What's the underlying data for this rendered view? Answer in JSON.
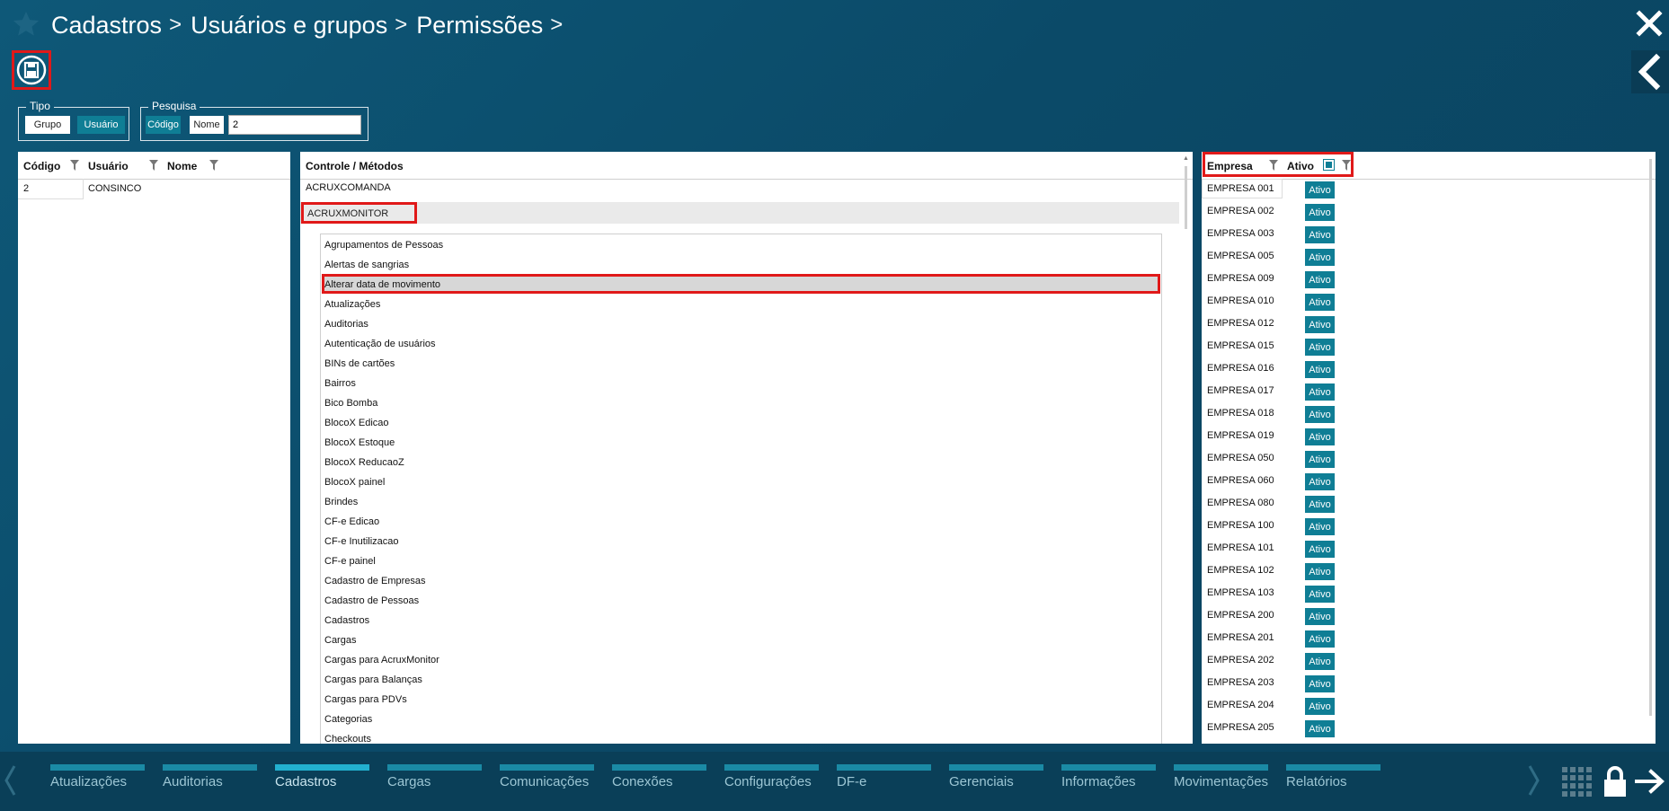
{
  "breadcrumb": [
    "Cadastros",
    "Usuários e grupos",
    "Permissões"
  ],
  "filters": {
    "tipo": {
      "legend": "Tipo",
      "grupo": "Grupo",
      "usuario": "Usuário"
    },
    "pesquisa": {
      "legend": "Pesquisa",
      "codigo": "Código",
      "nome": "Nome",
      "value": "2"
    }
  },
  "users": {
    "headers": [
      "Código",
      "Usuário",
      "Nome"
    ],
    "rows": [
      {
        "codigo": "2",
        "usuario": "CONSINCO",
        "nome": ""
      }
    ]
  },
  "controls": {
    "header": "Controle / Métodos",
    "tree": [
      "ACRUXCOMANDA",
      "ACRUXMONITOR"
    ],
    "methods": [
      "Agrupamentos de Pessoas",
      "Alertas de sangrias",
      "Alterar data de movimento",
      "Atualizações",
      "Auditorias",
      "Autenticação de usuários",
      "BINs de cartões",
      "Bairros",
      "Bico Bomba",
      "BlocoX Edicao",
      "BlocoX Estoque",
      "BlocoX ReducaoZ",
      "BlocoX painel",
      "Brindes",
      "CF-e Edicao",
      "CF-e Inutilizacao",
      "CF-e painel",
      "Cadastro de Empresas",
      "Cadastro de Pessoas",
      "Cadastros",
      "Cargas",
      "Cargas para AcruxMonitor",
      "Cargas para Balanças",
      "Cargas para PDVs",
      "Categorias",
      "Checkouts"
    ]
  },
  "empresas": {
    "headers": [
      "Empresa",
      "Ativo"
    ],
    "badge_label": "Ativo",
    "rows": [
      "EMPRESA 001",
      "EMPRESA 002",
      "EMPRESA 003",
      "EMPRESA 005",
      "EMPRESA 009",
      "EMPRESA 010",
      "EMPRESA 012",
      "EMPRESA 015",
      "EMPRESA 016",
      "EMPRESA 017",
      "EMPRESA 018",
      "EMPRESA 019",
      "EMPRESA 050",
      "EMPRESA 060",
      "EMPRESA 080",
      "EMPRESA 100",
      "EMPRESA 101",
      "EMPRESA 102",
      "EMPRESA 103",
      "EMPRESA 200",
      "EMPRESA 201",
      "EMPRESA 202",
      "EMPRESA 203",
      "EMPRESA 204",
      "EMPRESA 205"
    ]
  },
  "bottom_nav": {
    "tabs": [
      "Atualizações",
      "Auditorias",
      "Cadastros",
      "Cargas",
      "Comunicações",
      "Conexões",
      "Configurações",
      "DF-e",
      "Gerenciais",
      "Informações",
      "Movimentações",
      "Relatórios"
    ],
    "active": "Cadastros"
  },
  "colors": {
    "background": "#0c5070",
    "accent": "#0f7e95",
    "highlight": "#e01919"
  }
}
